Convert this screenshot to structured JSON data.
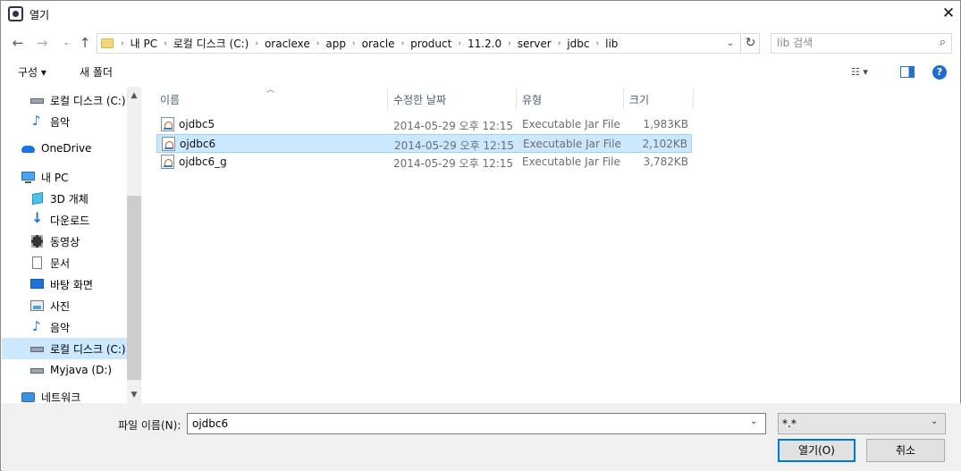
{
  "window": {
    "title": "열기"
  },
  "address": {
    "crumbs": [
      "내 PC",
      "로컬 디스크 (C:)",
      "oraclexe",
      "app",
      "oracle",
      "product",
      "11.2.0",
      "server",
      "jdbc",
      "lib"
    ],
    "search_placeholder": "lib 검색"
  },
  "toolbar": {
    "organize": "구성 ▾",
    "new_folder": "새 폴더"
  },
  "nav": {
    "items": [
      {
        "label": "로컬 디스크 (C:)",
        "icon": "drive-icon"
      },
      {
        "label": "음악",
        "icon": "music-icon"
      },
      {
        "label": "OneDrive",
        "icon": "cloud-icon"
      },
      {
        "label": "내 PC",
        "icon": "pc-icon"
      },
      {
        "label": "3D 개체",
        "icon": "cube-icon"
      },
      {
        "label": "다운로드",
        "icon": "download-icon"
      },
      {
        "label": "동영상",
        "icon": "video-icon"
      },
      {
        "label": "문서",
        "icon": "document-icon"
      },
      {
        "label": "바탕 화면",
        "icon": "desktop-icon"
      },
      {
        "label": "사진",
        "icon": "picture-icon"
      },
      {
        "label": "음악",
        "icon": "music-icon"
      },
      {
        "label": "로컬 디스크 (C:)",
        "icon": "drive-icon"
      },
      {
        "label": "Myjava (D:)",
        "icon": "drive-icon"
      },
      {
        "label": "네트워크",
        "icon": "network-icon"
      }
    ]
  },
  "columns": {
    "name": "이름",
    "date": "수정한 날짜",
    "type": "유형",
    "size": "크기"
  },
  "files": [
    {
      "name": "ojdbc5",
      "date": "2014-05-29 오후 12:15",
      "type": "Executable Jar File",
      "size": "1,983KB"
    },
    {
      "name": "ojdbc6",
      "date": "2014-05-29 오후 12:15",
      "type": "Executable Jar File",
      "size": "2,102KB"
    },
    {
      "name": "ojdbc6_g",
      "date": "2014-05-29 오후 12:15",
      "type": "Executable Jar File",
      "size": "3,782KB"
    }
  ],
  "bottom": {
    "filename_label": "파일 이름(N):",
    "filename_value": "ojdbc6",
    "filter": "*.*",
    "open_button": "열기(O)",
    "cancel_button": "취소"
  }
}
